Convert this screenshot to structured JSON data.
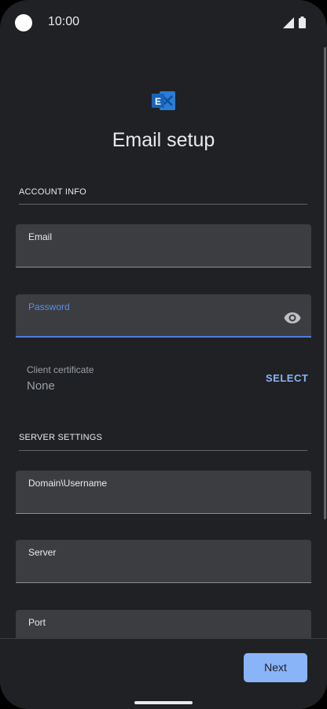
{
  "status_bar": {
    "time": "10:00"
  },
  "header": {
    "title": "Email setup",
    "logo_icon": "exchange-logo-icon",
    "accent": "#2b7cd3"
  },
  "account_info": {
    "section_label": "ACCOUNT INFO",
    "email_label": "Email",
    "password_label": "Password",
    "client_certificate": {
      "label": "Client certificate",
      "value": "None",
      "action": "SELECT"
    }
  },
  "server_settings": {
    "section_label": "SERVER SETTINGS",
    "domain_username_label": "Domain\\Username",
    "server_label": "Server",
    "port_label": "Port"
  },
  "footer": {
    "next_label": "Next",
    "accent": "#8ab4f8"
  }
}
